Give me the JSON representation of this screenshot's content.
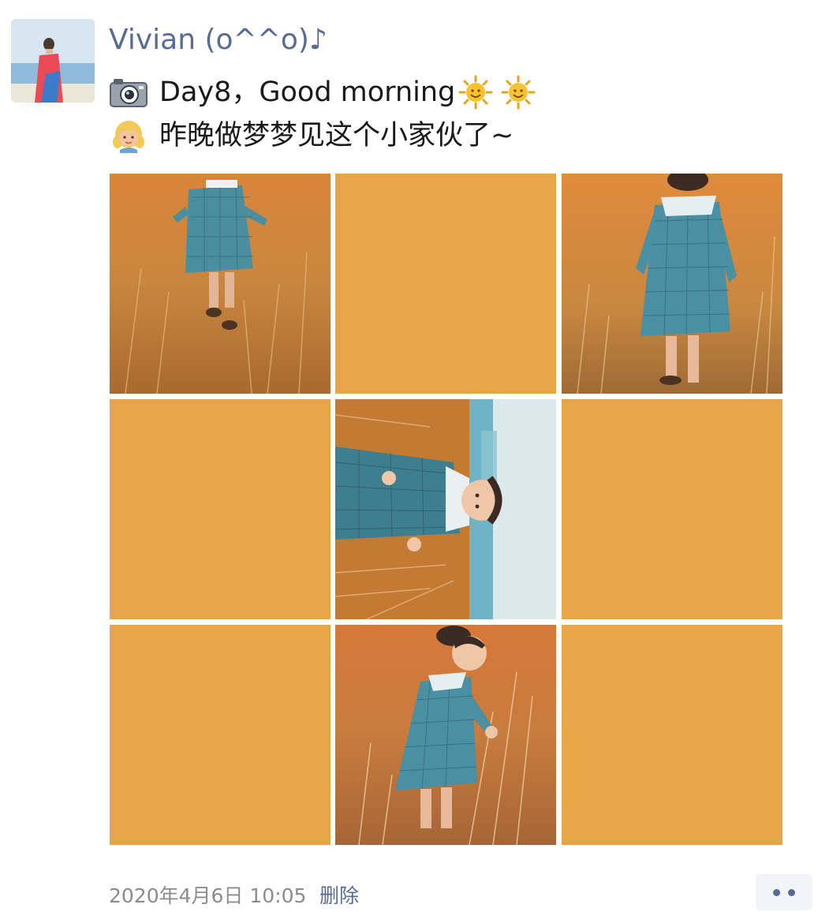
{
  "post": {
    "author": "Vivian (o^^o)♪",
    "line1": "Day8，Good morning",
    "line2": "昨晚做梦梦见这个小家伙了~",
    "line1_leading_icon": "camera-icon",
    "line1_trailing_icons": [
      "sun-emoji-icon",
      "sun-emoji-icon"
    ],
    "line2_leading_icon": "girl-emoji-icon"
  },
  "grid": {
    "cells": [
      {
        "kind": "photo",
        "subject": "girl in plaid dress walking away in golden grass"
      },
      {
        "kind": "blank"
      },
      {
        "kind": "photo",
        "subject": "girl in plaid dress walking away in golden grass"
      },
      {
        "kind": "blank"
      },
      {
        "kind": "photo",
        "subject": "girl in plaid dress, rotated sideways, facing camera"
      },
      {
        "kind": "blank"
      },
      {
        "kind": "blank"
      },
      {
        "kind": "photo",
        "subject": "girl in plaid dress reaching into golden grass"
      },
      {
        "kind": "blank"
      }
    ],
    "blank_color": "#E8A548"
  },
  "footer": {
    "timestamp": "2020年4月6日 10:05",
    "delete_label": "删除"
  },
  "colors": {
    "name_link": "#576B95",
    "body_text": "#1A1A1A",
    "meta_text": "#8C8C8C",
    "more_bg": "#F2F3F6"
  }
}
